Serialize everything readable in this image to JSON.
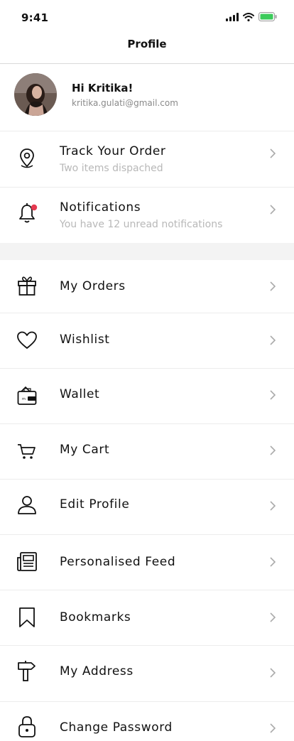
{
  "status": {
    "time": "9:41",
    "battery_color": "#3ccb5b"
  },
  "nav": {
    "title": "Profile"
  },
  "profile": {
    "greeting": "Hi Kritika!",
    "email": "kritika.gulati@gmail.com"
  },
  "menu": {
    "track_order": {
      "label": "Track Your Order",
      "sub": "Two items dispached",
      "icon": "location-pin-icon"
    },
    "notifications": {
      "label": "Notifications",
      "sub": "You have 12 unread notifications",
      "icon": "bell-icon",
      "badge_color": "#e53950"
    },
    "my_orders": {
      "label": "My Orders",
      "icon": "gift-icon"
    },
    "wishlist": {
      "label": "Wishlist",
      "icon": "heart-icon"
    },
    "wallet": {
      "label": "Wallet",
      "icon": "wallet-icon"
    },
    "my_cart": {
      "label": "My Cart",
      "icon": "cart-icon"
    },
    "edit_profile": {
      "label": "Edit Profile",
      "icon": "user-icon"
    },
    "personalised_feed": {
      "label": "Personalised Feed",
      "icon": "newspaper-icon"
    },
    "bookmarks": {
      "label": "Bookmarks",
      "icon": "bookmark-icon"
    },
    "my_address": {
      "label": "My Address",
      "icon": "signpost-icon"
    },
    "change_password": {
      "label": "Change Password",
      "icon": "lock-icon"
    }
  }
}
